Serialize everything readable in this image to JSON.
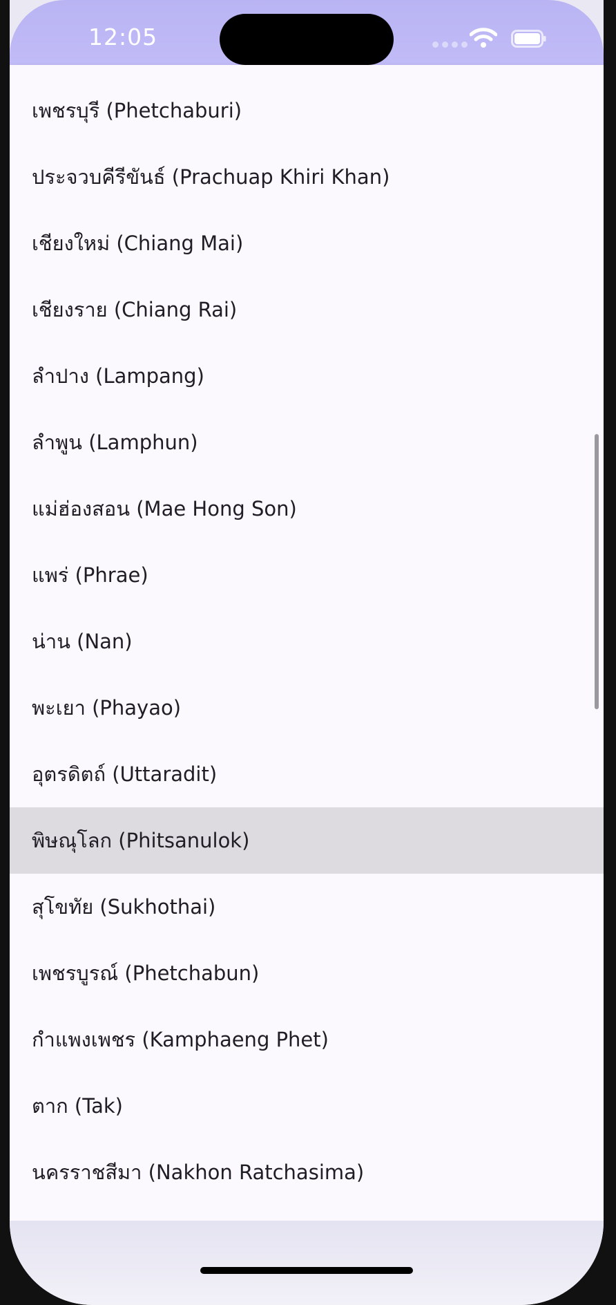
{
  "status_bar": {
    "time": "12:05",
    "icons": [
      "cellular-signal-icon",
      "wifi-icon",
      "battery-icon"
    ]
  },
  "province_list": {
    "items": [
      {
        "label": "เพชรบุรี (Phetchaburi)"
      },
      {
        "label": "ประจวบคีรีขันธ์ (Prachuap Khiri Khan)"
      },
      {
        "label": "เชียงใหม่ (Chiang Mai)"
      },
      {
        "label": "เชียงราย (Chiang Rai)"
      },
      {
        "label": "ลำปาง (Lampang)"
      },
      {
        "label": "ลำพูน (Lamphun)"
      },
      {
        "label": "แม่ฮ่องสอน (Mae Hong Son)"
      },
      {
        "label": "แพร่ (Phrae)"
      },
      {
        "label": "น่าน (Nan)"
      },
      {
        "label": "พะเยา (Phayao)"
      },
      {
        "label": "อุตรดิตถ์ (Uttaradit)"
      },
      {
        "label": "พิษณุโลก (Phitsanulok)",
        "selected": true
      },
      {
        "label": "สุโขทัย (Sukhothai)"
      },
      {
        "label": "เพชรบูรณ์ (Phetchabun)"
      },
      {
        "label": "กำแพงเพชร (Kamphaeng Phet)"
      },
      {
        "label": "ตาก (Tak)"
      },
      {
        "label": "นครราชสีมา (Nakhon Ratchasima)"
      }
    ]
  },
  "colors": {
    "status_bar": "#bcb7f5",
    "list_background": "#fbf8fe",
    "selected_row": "#dddbe0",
    "text": "#1f1e24"
  }
}
